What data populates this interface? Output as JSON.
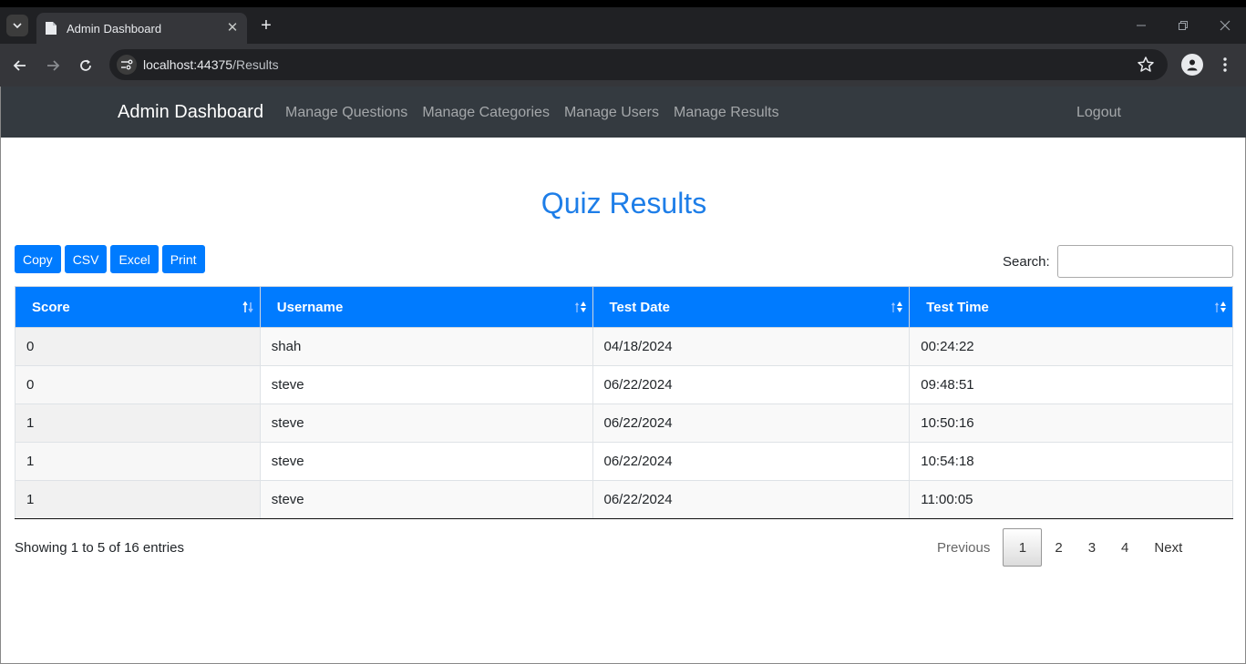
{
  "browser": {
    "tab_title": "Admin Dashboard",
    "url_host": "localhost:44375",
    "url_path": "/Results"
  },
  "navbar": {
    "brand": "Admin Dashboard",
    "links": [
      "Manage Questions",
      "Manage Categories",
      "Manage Users",
      "Manage Results"
    ],
    "logout": "Logout"
  },
  "page": {
    "title": "Quiz Results",
    "buttons": [
      "Copy",
      "CSV",
      "Excel",
      "Print"
    ],
    "search_label": "Search:",
    "search_value": ""
  },
  "table": {
    "headers": [
      "Score",
      "Username",
      "Test Date",
      "Test Time"
    ],
    "rows": [
      [
        "0",
        "shah",
        "04/18/2024",
        "00:24:22"
      ],
      [
        "0",
        "steve",
        "06/22/2024",
        "09:48:51"
      ],
      [
        "1",
        "steve",
        "06/22/2024",
        "10:50:16"
      ],
      [
        "1",
        "steve",
        "06/22/2024",
        "10:54:18"
      ],
      [
        "1",
        "steve",
        "06/22/2024",
        "11:00:05"
      ]
    ]
  },
  "footer": {
    "info": "Showing 1 to 5 of 16 entries",
    "previous": "Previous",
    "pages": [
      "1",
      "2",
      "3",
      "4"
    ],
    "current_page": "1",
    "next": "Next"
  },
  "colors": {
    "accent": "#007bff",
    "title": "#1e7ee8",
    "navbar": "#343a40"
  }
}
